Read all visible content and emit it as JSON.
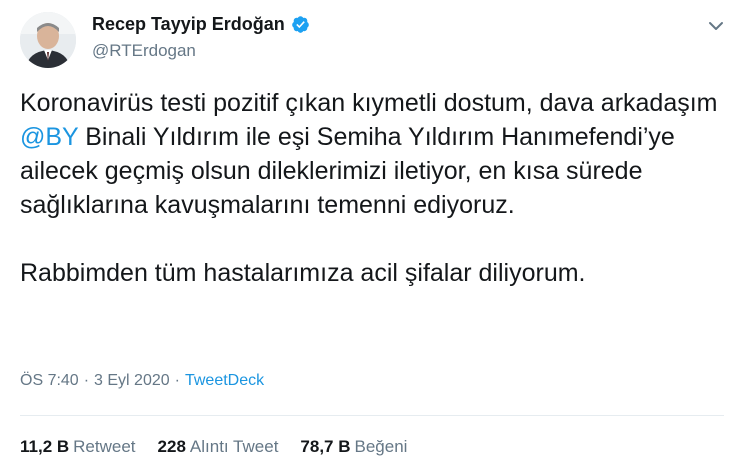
{
  "author": {
    "name": "Recep Tayyip Erdoğan",
    "handle": "@RTErdogan",
    "verified": true
  },
  "tweet": {
    "paragraph1": {
      "before_mention": "Koronavirüs testi pozitif çıkan kıymetli dostum, dava arkadaşım ",
      "mention": "@BY",
      "after_mention": " Binali Yıldırım ile eşi Semiha Yıldırım Hanımefendi’ye ailecek geçmiş olsun dileklerimizi iletiyor, en kısa sürede sağlıklarına kavuşmalarını temenni ediyoruz."
    },
    "paragraph2": "Rabbimden tüm hastalarımıza acil şifalar diliyorum."
  },
  "meta": {
    "time": "ÖS 7:40",
    "separator": "·",
    "date": "3 Eyl 2020",
    "source": "TweetDeck"
  },
  "stats": {
    "retweets": {
      "count": "11,2 B",
      "label": "Retweet"
    },
    "quotes": {
      "count": "228",
      "label": "Alıntı Tweet"
    },
    "likes": {
      "count": "78,7 B",
      "label": "Beğeni"
    }
  },
  "colors": {
    "accent": "#1b95e0",
    "secondary_text": "#657786",
    "primary_text": "#14171a",
    "verified_badge": "#1da1f2"
  },
  "icons": {
    "verified": "verified-badge-icon",
    "menu": "chevron-down-icon"
  }
}
